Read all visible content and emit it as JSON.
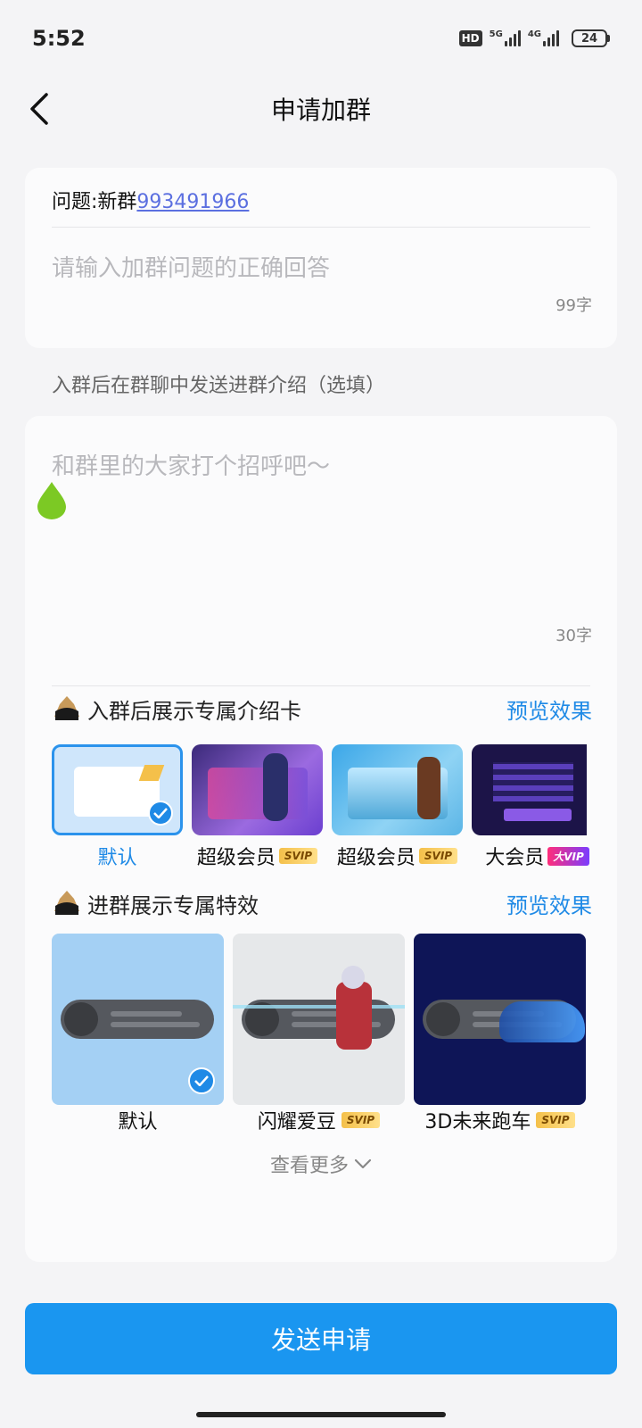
{
  "status_bar": {
    "time": "5:52",
    "hd_label": "HD",
    "net1_label": "5G",
    "net2_label": "4G",
    "battery": "24"
  },
  "nav": {
    "title": "申请加群"
  },
  "question": {
    "prefix": "问题:新群",
    "link_text": "993491966",
    "answer_placeholder": "请输入加群问题的正确回答",
    "char_count": "99字"
  },
  "intro": {
    "section_label": "入群后在群聊中发送进群介绍（选填）",
    "placeholder": "和群里的大家打个招呼吧～",
    "char_count": "30字"
  },
  "intro_cards": {
    "title": "入群后展示专属介绍卡",
    "preview": "预览效果",
    "items": [
      {
        "label": "默认",
        "badge": ""
      },
      {
        "label": "超级会员",
        "badge": "SVIP"
      },
      {
        "label": "超级会员",
        "badge": "SVIP"
      },
      {
        "label": "大会员",
        "badge": "大VIP"
      }
    ]
  },
  "effects": {
    "title": "进群展示专属特效",
    "preview": "预览效果",
    "items": [
      {
        "label": "默认",
        "badge": ""
      },
      {
        "label": "闪耀爱豆",
        "badge": "SVIP"
      },
      {
        "label": "3D未来跑车",
        "badge": "SVIP"
      }
    ],
    "more": "查看更多"
  },
  "submit": {
    "label": "发送申请"
  },
  "colors": {
    "accent": "#1a96f0",
    "link": "#5b6fe0",
    "svip": "#f4c04a"
  }
}
